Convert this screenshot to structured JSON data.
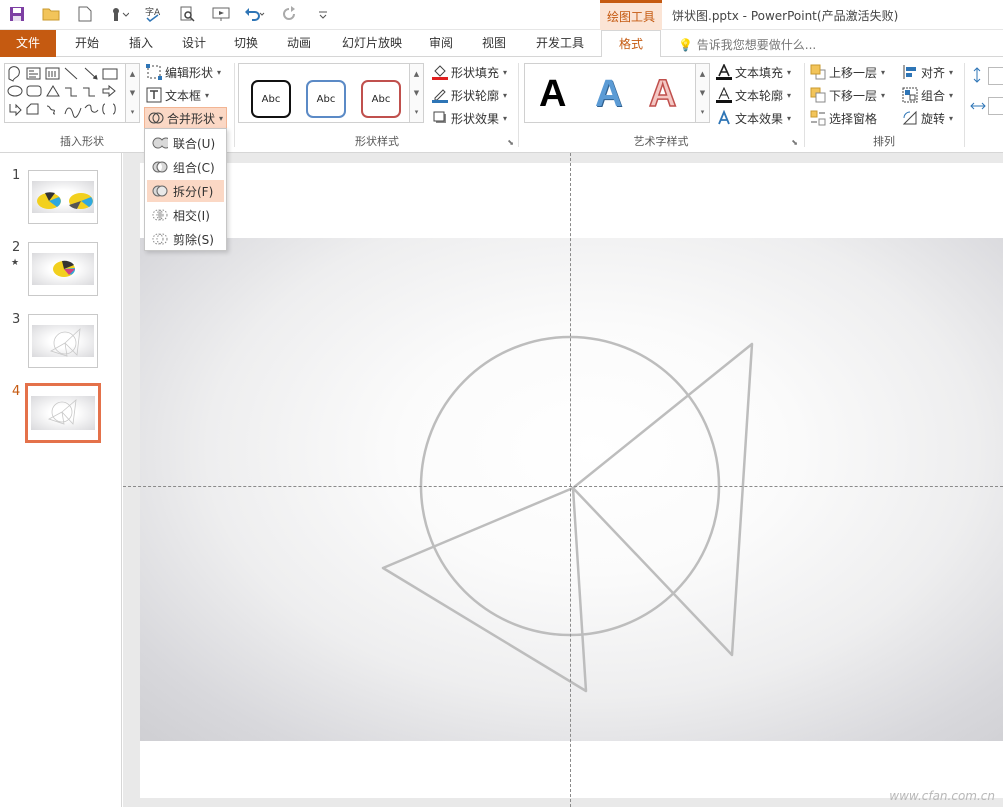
{
  "title_bar": {
    "context_tab": "绘图工具",
    "window_title": "饼状图.pptx - PowerPoint(产品激活失败)"
  },
  "tabs": {
    "file": "文件",
    "items": [
      "开始",
      "插入",
      "设计",
      "切换",
      "动画",
      "幻灯片放映",
      "审阅",
      "视图",
      "开发工具",
      "格式"
    ],
    "active": "格式",
    "tell_me_placeholder": "告诉我您想要做什么..."
  },
  "ribbon": {
    "insert_shapes": {
      "edit_shape": "编辑形状",
      "text_box": "文本框",
      "merge_shapes": "合并形状",
      "group_name": "插入形状"
    },
    "shape_styles": {
      "style_labels": [
        "Abc",
        "Abc",
        "Abc"
      ],
      "style_colors": [
        "#111111",
        "#5b8ac6",
        "#c0504d"
      ],
      "fill": "形状填充",
      "outline": "形状轮廓",
      "effects": "形状效果",
      "group_name": "形状样式"
    },
    "wordart": {
      "letters": [
        "A",
        "A",
        "A"
      ],
      "text_fill": "文本填充",
      "text_outline": "文本轮廓",
      "text_effects": "文本效果",
      "group_name": "艺术字样式"
    },
    "arrange": {
      "bring_forward": "上移一层",
      "send_backward": "下移一层",
      "selection_pane": "选择窗格",
      "align": "对齐",
      "group": "组合",
      "rotate": "旋转",
      "group_name": "排列"
    }
  },
  "merge_dropdown": {
    "items": [
      "联合(U)",
      "组合(C)",
      "拆分(F)",
      "相交(I)",
      "剪除(S)"
    ],
    "highlighted": "拆分(F)"
  },
  "slides": [
    {
      "number": "1",
      "star": ""
    },
    {
      "number": "2",
      "star": "★"
    },
    {
      "number": "3",
      "star": ""
    },
    {
      "number": "4",
      "star": ""
    }
  ],
  "active_slide": "4",
  "colors": {
    "accent": "#c55a11",
    "accent_light": "#fbd8c5",
    "thumb_active_border": "#e4714a",
    "shape_stroke": "#bdbdbd"
  },
  "watermark": "www.cfan.com.cn"
}
